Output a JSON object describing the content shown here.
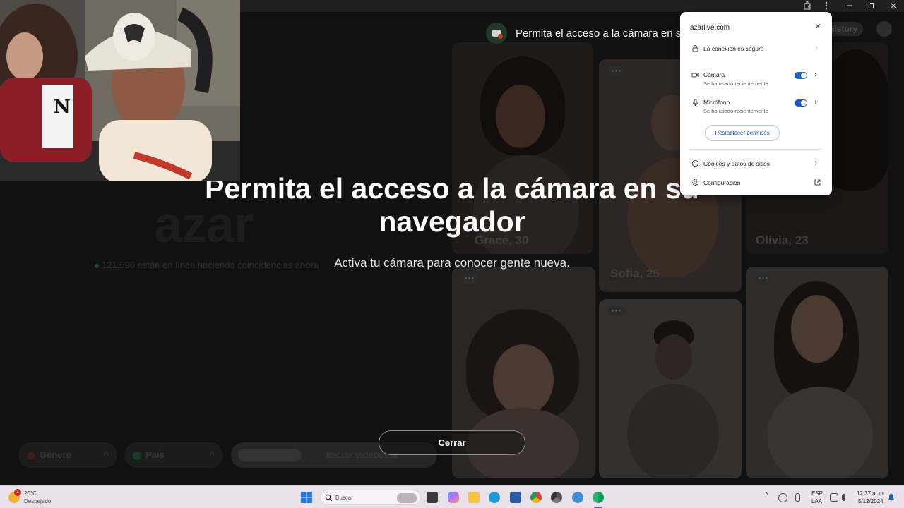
{
  "browser": {
    "extensions_icon": "puzzle-icon",
    "menu_icon": "kebab-menu-icon",
    "minimize_icon": "minimize-icon",
    "restore_icon": "restore-icon",
    "close_icon": "close-icon"
  },
  "app": {
    "logo": "azar",
    "online_text": "121,596 están en línea haciendo coincidencias ahora",
    "history_label": "History",
    "cards": [
      {
        "name": "Grace, 30"
      },
      {
        "name": "Olivia, 23"
      },
      {
        "name": "Sofia, 26"
      }
    ],
    "gender_label": "Género",
    "country_label": "País",
    "start_label": "Iniciar videochat"
  },
  "overlay": {
    "banner_text": "Permita el acceso a la cámara en su navegador",
    "title": "Permita el acceso a la cámara en su navegador",
    "subtitle": "Activa tu cámara para conocer gente nueva.",
    "close_button": "Cerrar"
  },
  "popup": {
    "domain": "azarlive.com",
    "close_glyph": "✕",
    "connection_label": "La conexión es segura",
    "camera": {
      "label": "Cámara",
      "sub": "Se ha usado recientemente",
      "enabled": true
    },
    "microphone": {
      "label": "Micrófono",
      "sub": "Se ha usado recientemente",
      "enabled": true
    },
    "reset_label": "Restablecer permisos",
    "cookies_label": "Cookies y datos de sitios",
    "settings_label": "Configuración",
    "chevron": "›"
  },
  "taskbar": {
    "weather_temp": "20°C",
    "weather_desc": "Despejado",
    "weather_badge": "1",
    "search_placeholder": "Buscar",
    "lang_top": "ESP",
    "lang_bottom": "LAA",
    "time": "12:37 a. m.",
    "date": "5/12/2024"
  },
  "colors": {
    "accent": "#1a5fd0",
    "overlay_bg": "#111111",
    "taskbar_bg": "#e9e2ea"
  }
}
